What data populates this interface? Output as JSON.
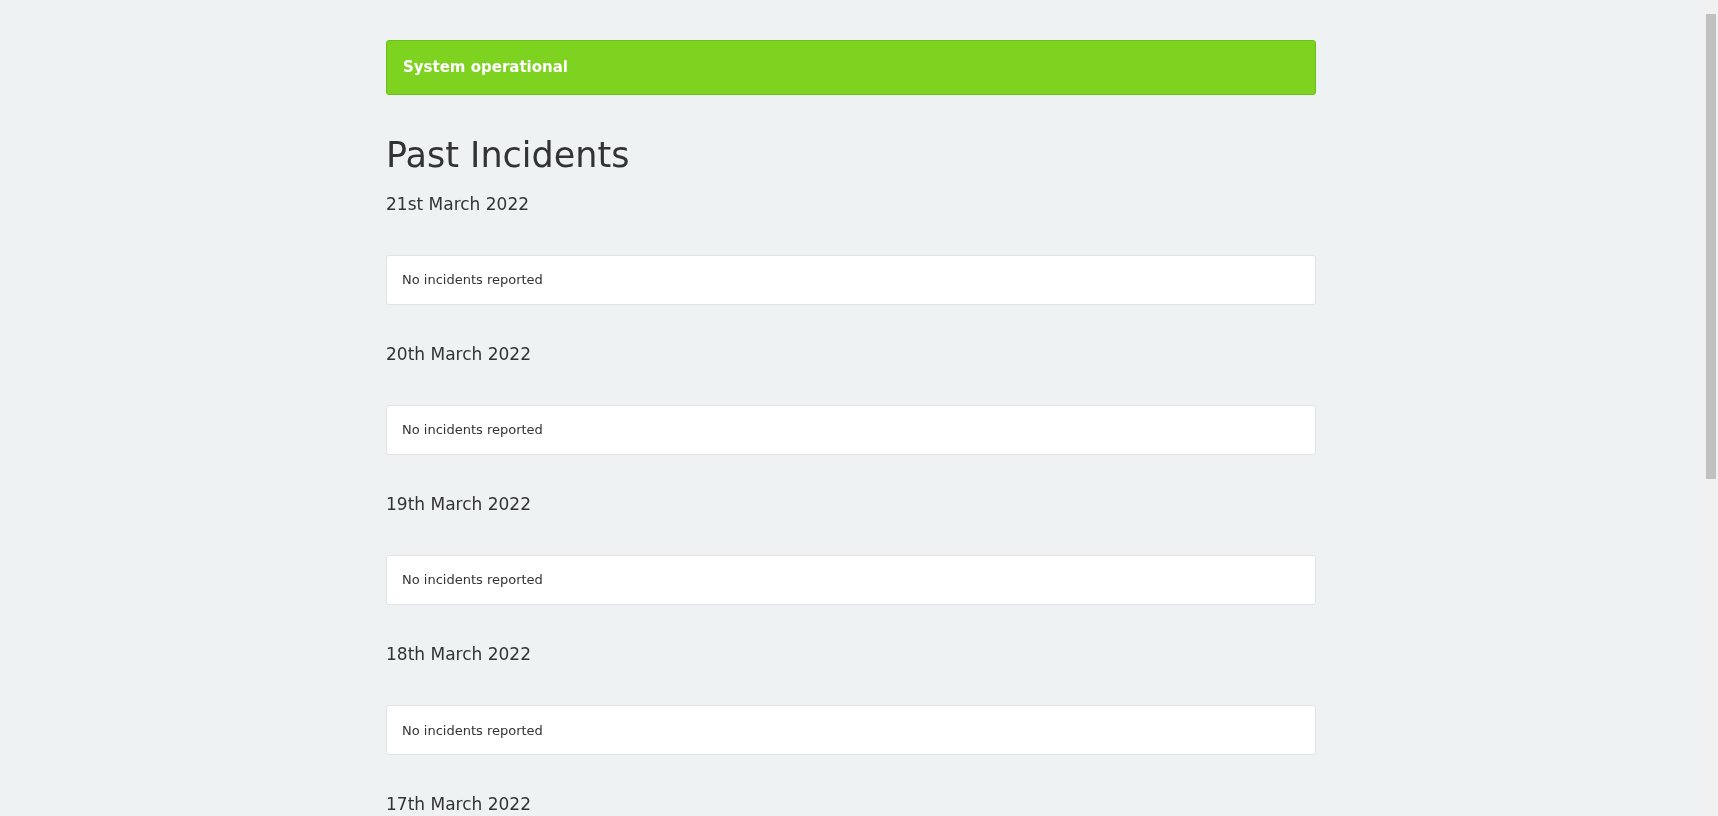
{
  "status_banner": {
    "text": "System operational"
  },
  "title": "Past Incidents",
  "days": [
    {
      "date": "21st March 2022",
      "message": "No incidents reported"
    },
    {
      "date": "20th March 2022",
      "message": "No incidents reported"
    },
    {
      "date": "19th March 2022",
      "message": "No incidents reported"
    },
    {
      "date": "18th March 2022",
      "message": "No incidents reported"
    },
    {
      "date": "17th March 2022"
    }
  ]
}
